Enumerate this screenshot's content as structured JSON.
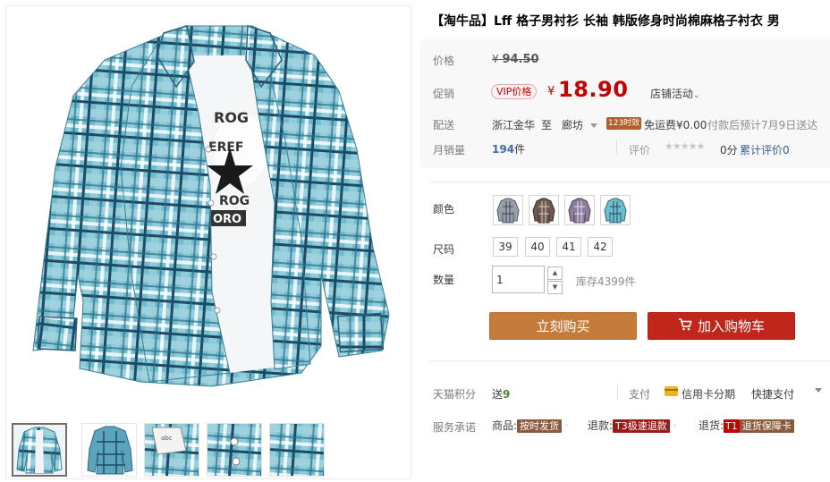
{
  "title": "【淘牛品】Lff 格子男衬衫 长袖 韩版修身时尚棉麻格子衬衣 男",
  "price": {
    "label": "价格",
    "symbol": "¥",
    "original": "94.50"
  },
  "promo": {
    "label": "促销",
    "vip_badge": "VIP价格",
    "symbol": "¥",
    "price": "18.90",
    "shop_activity": "店铺活动"
  },
  "shipping": {
    "label": "配送",
    "from": "浙江金华",
    "to_word": "至",
    "to": "廊坊",
    "badge": "123时效",
    "fee": "免运费¥0.00",
    "eta": "付款后预计7月9日送达"
  },
  "sales": {
    "label": "月销量",
    "count": "194",
    "unit": "件",
    "rating_label": "评价",
    "rating_score": "0分",
    "review_link": "累计评价0"
  },
  "color": {
    "label": "颜色",
    "swatches": [
      "灰色格子",
      "咖啡格子",
      "紫色格子",
      "蓝色格子"
    ]
  },
  "size": {
    "label": "尺码",
    "options": [
      "39",
      "40",
      "41",
      "42"
    ]
  },
  "quantity": {
    "label": "数量",
    "value": "1",
    "stock": "库存4399件"
  },
  "actions": {
    "buy": "立刻购买",
    "cart": "加入购物车"
  },
  "points": {
    "label": "天猫积分",
    "text": "送",
    "value": "9"
  },
  "payment": {
    "label": "支付",
    "credit": "信用卡分期",
    "quick": "快捷支付"
  },
  "service": {
    "label": "服务承诺",
    "goods_label": "商品:",
    "goods_tag": "按时发货",
    "refund_label": "退款:",
    "refund_tag": "T3极速退款",
    "return_label": "退货:",
    "return_tag_prefix": "T1",
    "return_tag": "退货保障卡"
  },
  "colors": {
    "shirt_blue": "#5fb0c4",
    "shirt_dark": "#1f4a66",
    "price_red": "#c40000",
    "buy_btn": "#c47b3c",
    "cart_btn": "#c0261a"
  }
}
